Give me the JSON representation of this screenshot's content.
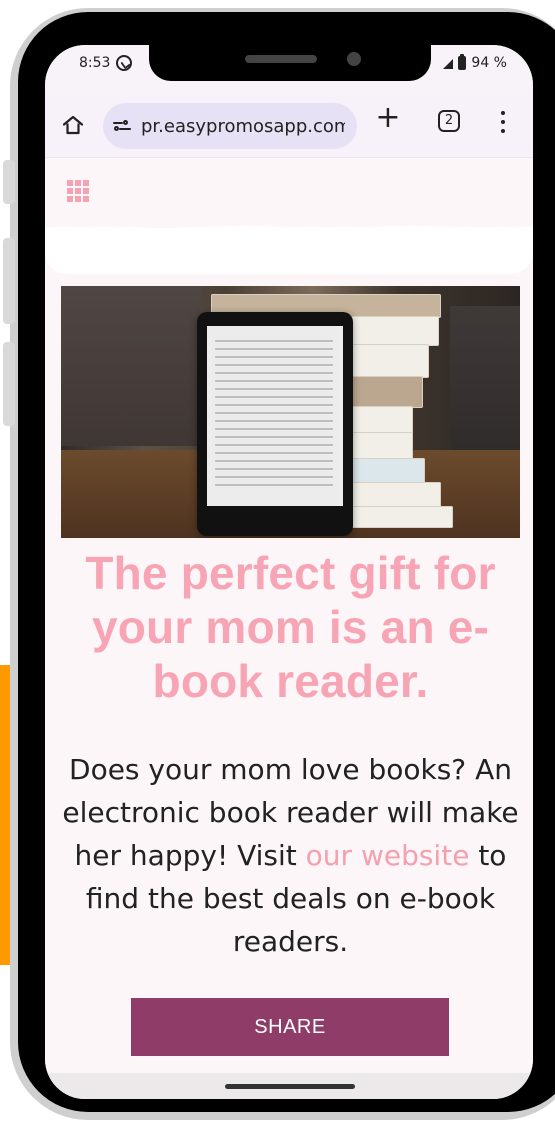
{
  "status_bar": {
    "time": "8:53",
    "battery": "94 %",
    "icons": [
      "whatsapp-icon",
      "signal-icon",
      "battery-icon"
    ]
  },
  "browser": {
    "url": "pr.easypromosapp.com/",
    "tabs_count": "2",
    "icons": [
      "home-icon",
      "site-settings-icon",
      "plus-icon",
      "tabs-icon",
      "menu-icon"
    ]
  },
  "page": {
    "headline": "The perfect gift for your mom is an e-book reader.",
    "body_before_link": "Does your mom love books? An electronic book reader will make her happy! Visit ",
    "body_link": "our website",
    "body_after_link": " to find the best deals on e-book readers.",
    "share_label": "SHARE"
  },
  "colors": {
    "accent_pink": "#f7a5b4",
    "share_button": "#8f3c69",
    "orange_strip": "#ff9900"
  }
}
